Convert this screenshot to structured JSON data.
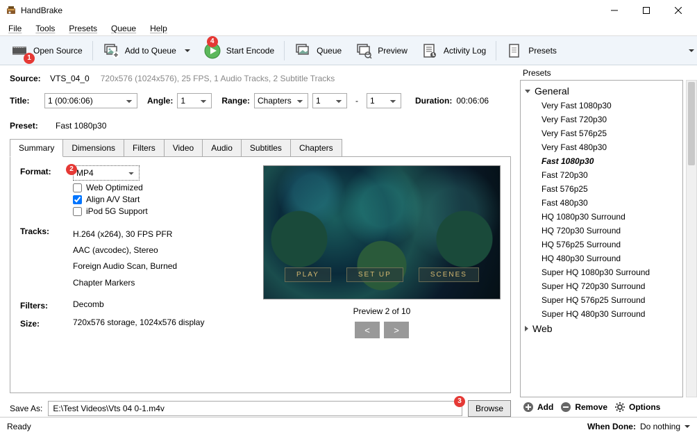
{
  "app": {
    "title": "HandBrake"
  },
  "menu": {
    "file": "File",
    "tools": "Tools",
    "presets": "Presets",
    "queue": "Queue",
    "help": "Help"
  },
  "toolbar": {
    "open_source": "Open Source",
    "add_to_queue": "Add to Queue",
    "start_encode": "Start Encode",
    "queue": "Queue",
    "preview": "Preview",
    "activity_log": "Activity Log",
    "presets": "Presets"
  },
  "badges": {
    "b1": "1",
    "b2": "2",
    "b3": "3",
    "b4": "4"
  },
  "source": {
    "label": "Source:",
    "name": "VTS_04_0",
    "meta": "720x576 (1024x576), 25 FPS, 1 Audio Tracks, 2 Subtitle Tracks"
  },
  "titlerow": {
    "title_label": "Title:",
    "title_value": "1  (00:06:06)",
    "angle_label": "Angle:",
    "angle_value": "1",
    "range_label": "Range:",
    "range_type": "Chapters",
    "range_from": "1",
    "range_dash": "-",
    "range_to": "1",
    "duration_label": "Duration:",
    "duration_value": "00:06:06"
  },
  "presetrow": {
    "label": "Preset:",
    "value": "Fast 1080p30"
  },
  "tabs": {
    "summary": "Summary",
    "dimensions": "Dimensions",
    "filters": "Filters",
    "video": "Video",
    "audio": "Audio",
    "subtitles": "Subtitles",
    "chapters": "Chapters"
  },
  "summary": {
    "format_label": "Format:",
    "format_value": "MP4",
    "web_optimized": "Web Optimized",
    "align_av": "Align A/V Start",
    "ipod": "iPod 5G Support",
    "tracks_label": "Tracks:",
    "track1": "H.264 (x264), 30 FPS PFR",
    "track2": "AAC (avcodec), Stereo",
    "track3": "Foreign Audio Scan, Burned",
    "track4": "Chapter Markers",
    "filters_label": "Filters:",
    "filters_value": "Decomb",
    "size_label": "Size:",
    "size_value": "720x576 storage, 1024x576 display"
  },
  "preview": {
    "menu_play": "PLAY",
    "menu_setup": "SET UP",
    "menu_scenes": "SCENES",
    "label": "Preview 2 of 10",
    "prev": "<",
    "next": ">"
  },
  "saveas": {
    "label": "Save As:",
    "value": "E:\\Test Videos\\Vts 04 0-1.m4v",
    "browse": "Browse"
  },
  "presets_panel": {
    "title": "Presets",
    "group_general": "General",
    "items": [
      "Very Fast 1080p30",
      "Very Fast 720p30",
      "Very Fast 576p25",
      "Very Fast 480p30",
      "Fast 1080p30",
      "Fast 720p30",
      "Fast 576p25",
      "Fast 480p30",
      "HQ 1080p30 Surround",
      "HQ 720p30 Surround",
      "HQ 576p25 Surround",
      "HQ 480p30 Surround",
      "Super HQ 1080p30 Surround",
      "Super HQ 720p30 Surround",
      "Super HQ 576p25 Surround",
      "Super HQ 480p30 Surround"
    ],
    "group_web": "Web",
    "add": "Add",
    "remove": "Remove",
    "options": "Options"
  },
  "status": {
    "ready": "Ready",
    "when_done_label": "When Done:",
    "when_done_value": "Do nothing"
  }
}
